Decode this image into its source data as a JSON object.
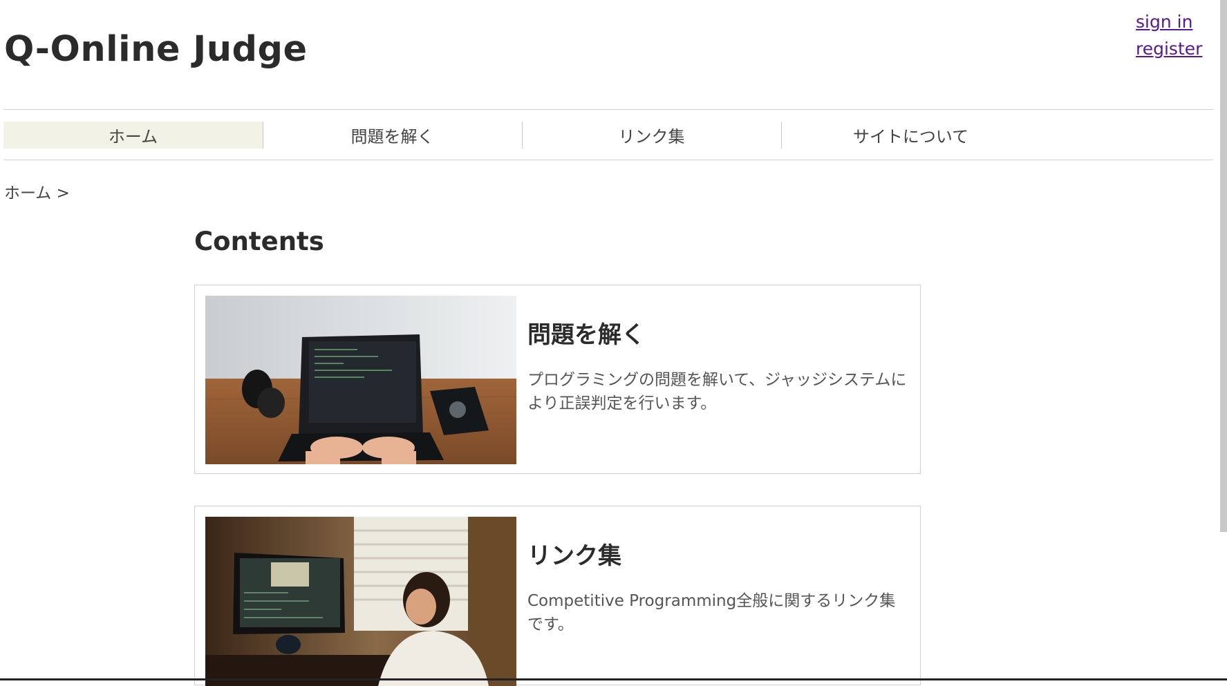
{
  "site": {
    "title": "Q-Online Judge"
  },
  "auth": {
    "sign_in": "sign in",
    "register": "register"
  },
  "nav": {
    "items": [
      {
        "label": "ホーム"
      },
      {
        "label": "問題を解く"
      },
      {
        "label": "リンク集"
      },
      {
        "label": "サイトについて"
      }
    ]
  },
  "breadcrumb": {
    "text": "ホーム >"
  },
  "main": {
    "section_title": "Contents",
    "cards": [
      {
        "title": "問題を解く",
        "description": "プログラミングの問題を解いて、ジャッジシステムにより正誤判定を行います。"
      },
      {
        "title": "リンク集",
        "description": "Competitive Programming全般に関するリンク集です。"
      }
    ]
  },
  "colors": {
    "active_nav_bg": "#f2f2e6",
    "link_visited": "#551a8b",
    "border": "#cfcfcf",
    "text": "#2b2b2b"
  },
  "icons": {
    "card_1_image": "laptop-coding-photo",
    "card_2_image": "person-at-monitor-photo"
  }
}
